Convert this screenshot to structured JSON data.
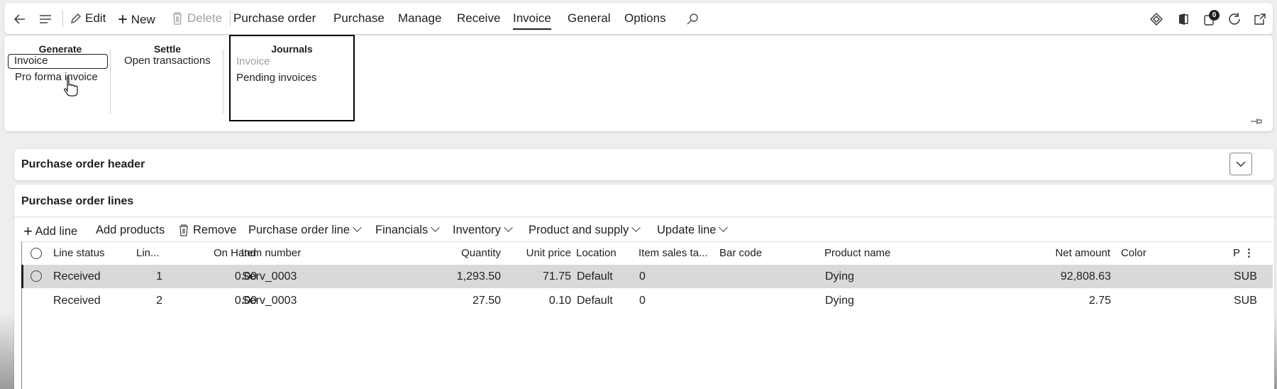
{
  "toolbar": {
    "back_icon": "arrow-left-icon",
    "menu_icon": "hamburger-icon",
    "edit": "Edit",
    "new": "New",
    "delete": "Delete",
    "tabs": [
      "Purchase order",
      "Purchase",
      "Manage",
      "Receive",
      "Invoice",
      "General",
      "Options"
    ],
    "active_tab": "Invoice",
    "notification_count": "0"
  },
  "ribbon": {
    "groups": [
      {
        "title": "Generate",
        "items": [
          "Invoice",
          "Pro forma invoice"
        ]
      },
      {
        "title": "Settle",
        "items": [
          "Open transactions"
        ]
      },
      {
        "title": "Journals",
        "items": [
          "Invoice",
          "Pending invoices"
        ]
      }
    ]
  },
  "header_panel": {
    "title": "Purchase order header"
  },
  "lines_panel": {
    "title": "Purchase order lines",
    "actions": {
      "add_line": "Add line",
      "add_products": "Add products",
      "remove": "Remove",
      "menus": [
        "Purchase order line",
        "Financials",
        "Inventory",
        "Product and supply",
        "Update line"
      ]
    },
    "columns": [
      "Line status",
      "Lin...",
      "On Hand",
      "Item number",
      "Quantity",
      "Unit price",
      "Location",
      "Item sales ta...",
      "Bar code",
      "Product name",
      "Net amount",
      "Color",
      "P"
    ],
    "rows": [
      {
        "status": "Received",
        "line": "1",
        "on_hand": "0.00",
        "item": "Serv_0003",
        "qty": "1,293.50",
        "price": "71.75",
        "location": "Default",
        "tax": "0",
        "barcode": "",
        "product": "Dying",
        "net": "92,808.63",
        "color": "",
        "p": "SUB"
      },
      {
        "status": "Received",
        "line": "2",
        "on_hand": "0.00",
        "item": "Serv_0003",
        "qty": "27.50",
        "price": "0.10",
        "location": "Default",
        "tax": "0",
        "barcode": "",
        "product": "Dying",
        "net": "2.75",
        "color": "",
        "p": "SUB"
      }
    ]
  }
}
